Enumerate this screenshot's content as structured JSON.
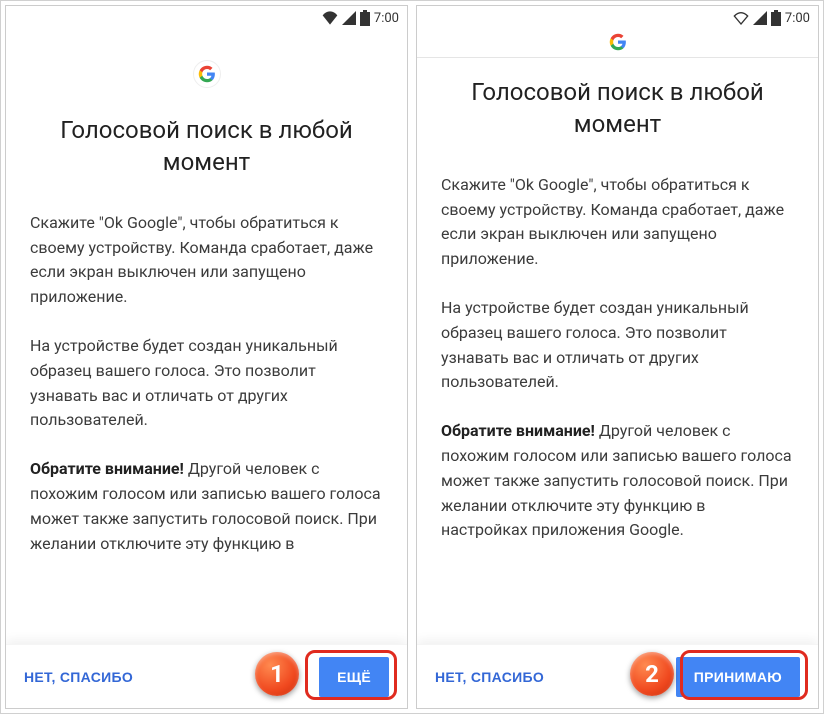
{
  "status": {
    "time": "7:00"
  },
  "screen1": {
    "title": "Голосовой поиск в любой момент",
    "p1": "Скажите \"Ok Google\", чтобы обратиться к своему устройству. Команда сработает, даже если экран выключен или запущено приложение.",
    "p2": "На устройстве будет создан уникальный образец вашего голоса. Это позволит узнавать вас и отличать от других пользователей.",
    "p3_bold": "Обратите внимание!",
    "p3_rest": " Другой человек с похожим голосом или записью вашего голоса может также запустить голосовой поиск. При желании отключите эту функцию в",
    "decline": "НЕТ, СПАСИБО",
    "more": "ЕЩЁ",
    "step": "1"
  },
  "screen2": {
    "title": "Голосовой поиск в любой момент",
    "p1": "Скажите \"Ok Google\", чтобы обратиться к своему устройству. Команда сработает, даже если экран выключен или запущено приложение.",
    "p2": "На устройстве будет создан уникальный образец вашего голоса. Это позволит узнавать вас и отличать от других пользователей.",
    "p3_bold": "Обратите внимание!",
    "p3_rest": " Другой человек с похожим голосом или записью вашего голоса может также запустить голосовой поиск. При желании отключите эту функцию в настройках приложения Google.",
    "decline": "НЕТ, СПАСИБО",
    "accept": "ПРИНИМАЮ",
    "step": "2"
  }
}
